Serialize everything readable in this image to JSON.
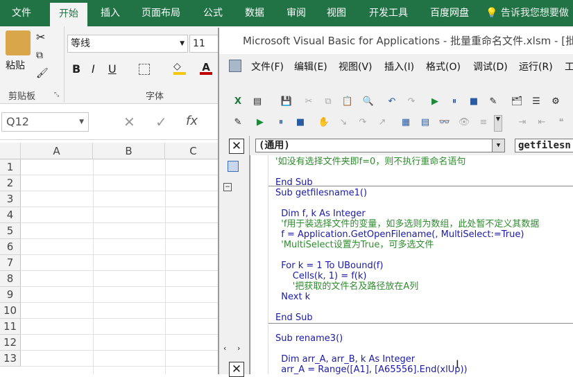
{
  "ribbon": {
    "tabs": [
      "文件",
      "开始",
      "插入",
      "页面布局",
      "公式",
      "数据",
      "审阅",
      "视图",
      "开发工具",
      "百度网盘"
    ],
    "active_tab": "开始",
    "tell_me": "告诉我您想要做",
    "paste_label": "粘贴",
    "clipboard_label": "剪贴板",
    "font_group_label": "字体",
    "font_name": "等线",
    "font_size": "11",
    "bold": "B",
    "italic": "I",
    "underline": "U",
    "accent_color": "#217346"
  },
  "formula_bar": {
    "name_box": "Q12",
    "fx": "fx"
  },
  "grid": {
    "columns": [
      "A",
      "B",
      "C"
    ],
    "rows": [
      "1",
      "2",
      "3",
      "4",
      "5",
      "6",
      "7",
      "8",
      "9",
      "10",
      "11",
      "12",
      "13"
    ]
  },
  "vba": {
    "title": "Microsoft Visual Basic for Applications - 批量重命名文件.xlsm - [批量",
    "menus": [
      "文件(F)",
      "编辑(E)",
      "视图(V)",
      "插入(I)",
      "格式(O)",
      "调试(D)",
      "运行(R)",
      "工"
    ],
    "object_combo": "(通用)",
    "proc_combo": "getfilesn",
    "code_lines": [
      {
        "text": "'如没有选择文件夹即f=0，则不执行重命名语句",
        "kind": "cm"
      },
      {
        "text": "End Sub",
        "kind": "kw"
      },
      {
        "text": "Sub getfilesname1()",
        "kind": "kw"
      },
      {
        "text": "  Dim f, k As Integer",
        "kind": "kw"
      },
      {
        "text": "  'f用于装选择文件的变量，如多选则为数组，此处暂不定义其数据",
        "kind": "cm"
      },
      {
        "text": "  f = Application.GetOpenFilename(, MultiSelect:=True)",
        "kind": "kw"
      },
      {
        "text": "  'MultiSelect设置为True，可多选文件",
        "kind": "cm"
      },
      {
        "text": "  For k = 1 To UBound(f)",
        "kind": "kw"
      },
      {
        "text": "      Cells(k, 1) = f(k)",
        "kind": "kw"
      },
      {
        "text": "      '把获取的文件名及路径放在A列",
        "kind": "cm"
      },
      {
        "text": "  Next k",
        "kind": "kw"
      },
      {
        "text": "End Sub",
        "kind": "kw"
      },
      {
        "text": "Sub rename3()",
        "kind": "kw"
      },
      {
        "text": "  Dim arr_A, arr_B, k As Integer",
        "kind": "kw"
      },
      {
        "text": "  arr_A = Range([A1], [A65556].End(xlUp))",
        "kind": "kw"
      }
    ]
  }
}
